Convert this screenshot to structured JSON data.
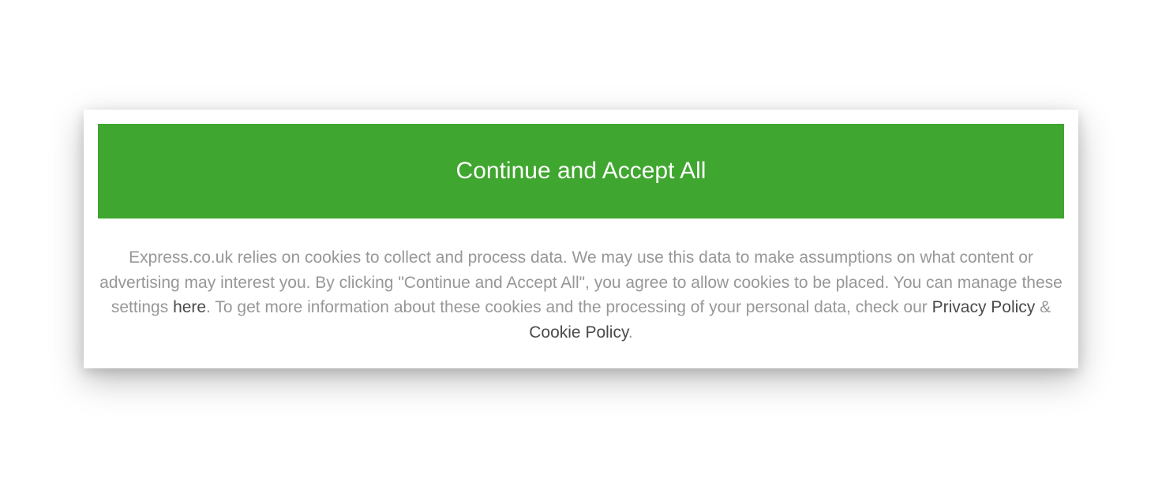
{
  "cookieBanner": {
    "acceptButtonLabel": "Continue and Accept All",
    "bodyPart1": "Express.co.uk relies on cookies to collect and process data. We may use this data to make assumptions on what content or advertising may interest you. By clicking \"Continue and Accept All\", you agree to allow cookies to be placed. You can manage these settings ",
    "hereLink": "here",
    "bodyPart2": ". To get more information about these cookies and the processing of your personal data, check our ",
    "privacyPolicyLink": "Privacy Policy",
    "ampersand": " & ",
    "cookiePolicyLink": "Cookie Policy",
    "bodyPart3": "."
  }
}
